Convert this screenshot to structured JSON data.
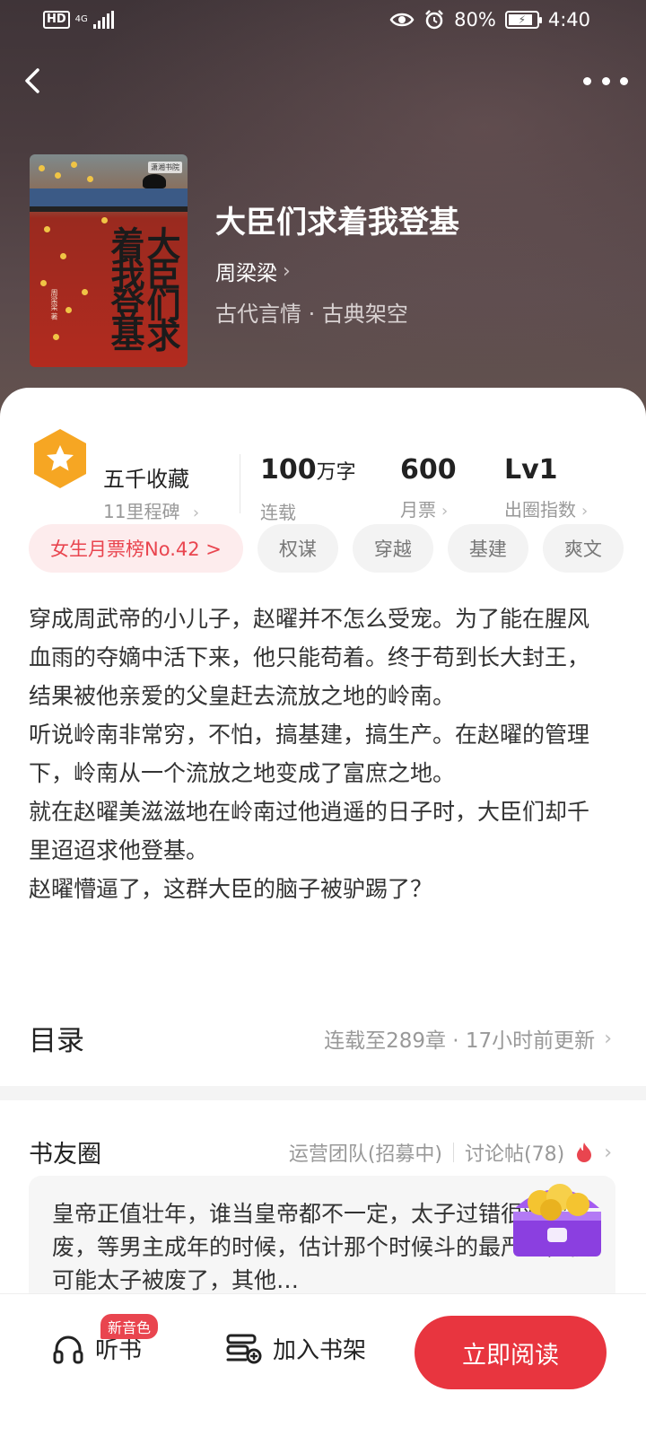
{
  "status": {
    "time": "4:40",
    "battery": "80%",
    "network": "4G",
    "hd": "HD"
  },
  "book": {
    "title": "大臣们求着我登基",
    "author": "周梁梁",
    "genre": "古代言情 · 古典架空",
    "cover_title": "大臣们求着我登基",
    "cover_publisher": "潇湘书院",
    "cover_author": "周梁梁 著"
  },
  "stats": {
    "favorites": "五千收藏",
    "favorites_sub": "11里程碑",
    "words_value": "100",
    "words_unit": "万字",
    "words_label": "连载",
    "tickets_value": "600",
    "tickets_label": "月票",
    "level_value": "Lv1",
    "level_label": "出圈指数"
  },
  "tags": [
    "女生月票榜No.42 >",
    "权谋",
    "穿越",
    "基建",
    "爽文"
  ],
  "description": [
    "穿成周武帝的小儿子，赵曜并不怎么受宠。为了能在腥风血雨的夺嫡中活下来，他只能苟着。终于苟到长大封王，结果被他亲爱的父皇赶去流放之地的岭南。",
    "听说岭南非常穷，不怕，搞基建，搞生产。在赵曜的管理下，岭南从一个流放之地变成了富庶之地。",
    "就在赵曜美滋滋地在岭南过他逍遥的日子时，大臣们却千里迢迢求他登基。",
    "赵曜懵逼了，这群大臣的脑子被驴踢了？"
  ],
  "catalog": {
    "title": "目录",
    "info": "连载至289章 · 17小时前更新"
  },
  "circle": {
    "title": "书友圈",
    "ops_team": "运营团队(招募中)",
    "threads": "讨论帖(78)",
    "post": "皇帝正值壮年，谁当皇帝都不一定，太子过错很难被废，等男主成年的时候，估计那个时候斗的最严重，很可能太子被废了，其他…"
  },
  "bottom": {
    "listen": "听书",
    "new_voice": "新音色",
    "add_shelf": "加入书架",
    "read_now": "立即阅读"
  },
  "colors": {
    "accent": "#e8353f",
    "star": "#f6a623",
    "hero": "#4a3c3f"
  }
}
